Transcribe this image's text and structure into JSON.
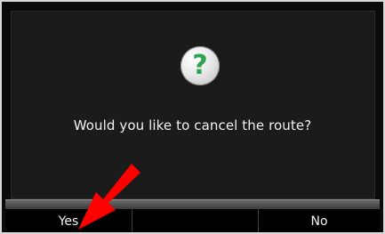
{
  "dialog": {
    "icon": "help-question-icon",
    "icon_glyph": "?",
    "message": "Would you like to cancel the route?"
  },
  "buttons": {
    "yes_label": "Yes",
    "middle_label": "",
    "no_label": "No"
  },
  "overlay": {
    "arrow_icon": "red-arrow-icon",
    "arrow_color": "#ff0000"
  },
  "colors": {
    "background": "#0b0b0b",
    "dialog": "#1b1b1b",
    "text": "#f2f2f2",
    "icon_accent": "#2ea44f"
  }
}
